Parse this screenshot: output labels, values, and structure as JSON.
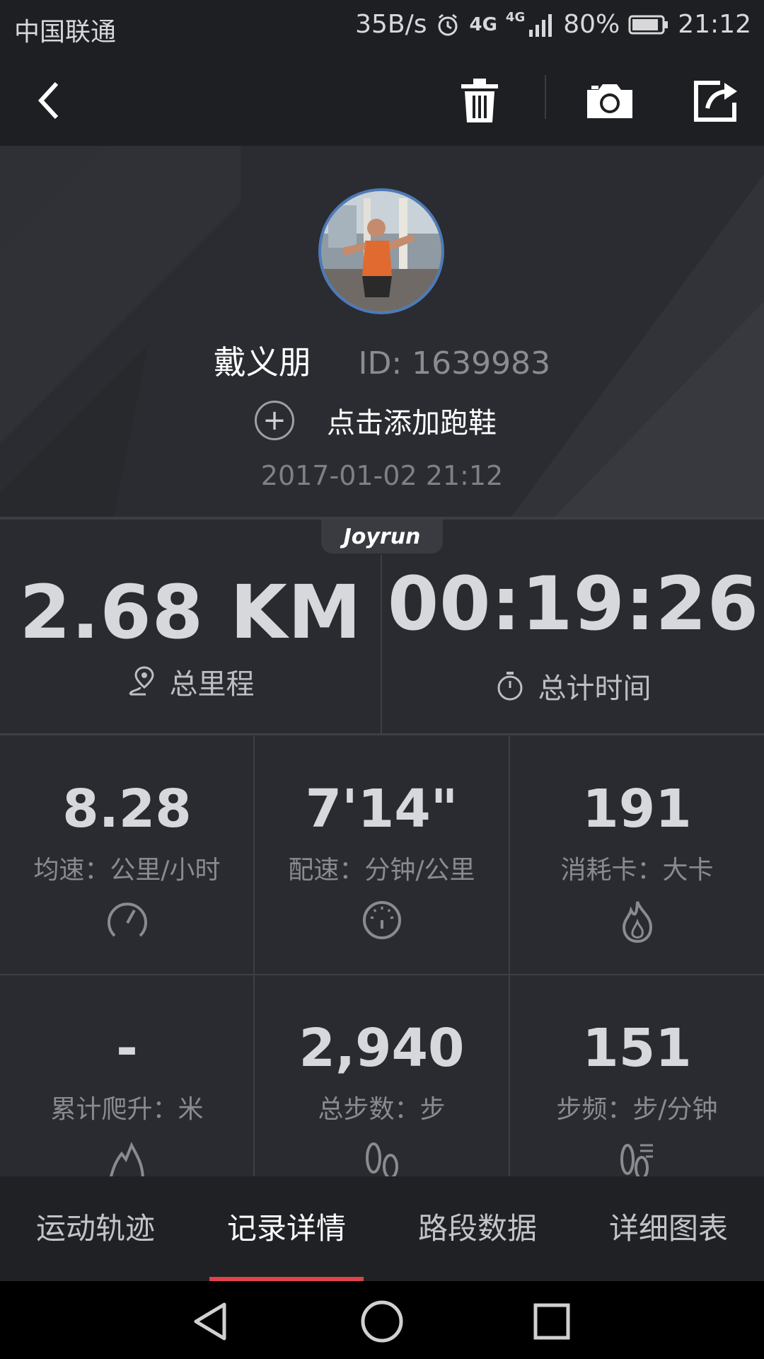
{
  "status_bar": {
    "carrier": "中国联通",
    "speed": "35B/s",
    "net1": "4G",
    "net2": "4G",
    "battery": "80%",
    "time": "21:12"
  },
  "toolbar": {
    "back_icon": "chevron-left-icon",
    "delete_icon": "trash-icon",
    "camera_icon": "camera-icon",
    "share_icon": "share-icon"
  },
  "profile": {
    "name": "戴义朋",
    "user_id": "ID: 1639983",
    "add_shoe_plus": "+",
    "add_shoe_label": "点击添加跑鞋",
    "datetime": "2017-01-02 21:12"
  },
  "brand": "Joyrun",
  "summary": {
    "distance_value": "2.68 KM",
    "distance_label": "总里程",
    "time_value": "00:19:26",
    "time_label": "总计时间"
  },
  "stats": [
    {
      "value": "8.28",
      "label": "均速：公里/小时",
      "icon": "speedometer-icon"
    },
    {
      "value": "7'14\"",
      "label": "配速：分钟/公里",
      "icon": "pace-gauge-icon"
    },
    {
      "value": "191",
      "label": "消耗卡：大卡",
      "icon": "flame-icon"
    },
    {
      "value": "-",
      "label": "累计爬升：米",
      "icon": "mountain-icon"
    },
    {
      "value": "2,940",
      "label": "总步数：步",
      "icon": "footprints-icon"
    },
    {
      "value": "151",
      "label": "步频：步/分钟",
      "icon": "cadence-icon"
    }
  ],
  "tabs": [
    {
      "label": "运动轨迹",
      "active": false
    },
    {
      "label": "记录详情",
      "active": true
    },
    {
      "label": "路段数据",
      "active": false
    },
    {
      "label": "详细图表",
      "active": false
    }
  ],
  "colors": {
    "accent": "#e0424a",
    "background": "#2a2b30",
    "avatar_border": "#4d7ab8"
  }
}
